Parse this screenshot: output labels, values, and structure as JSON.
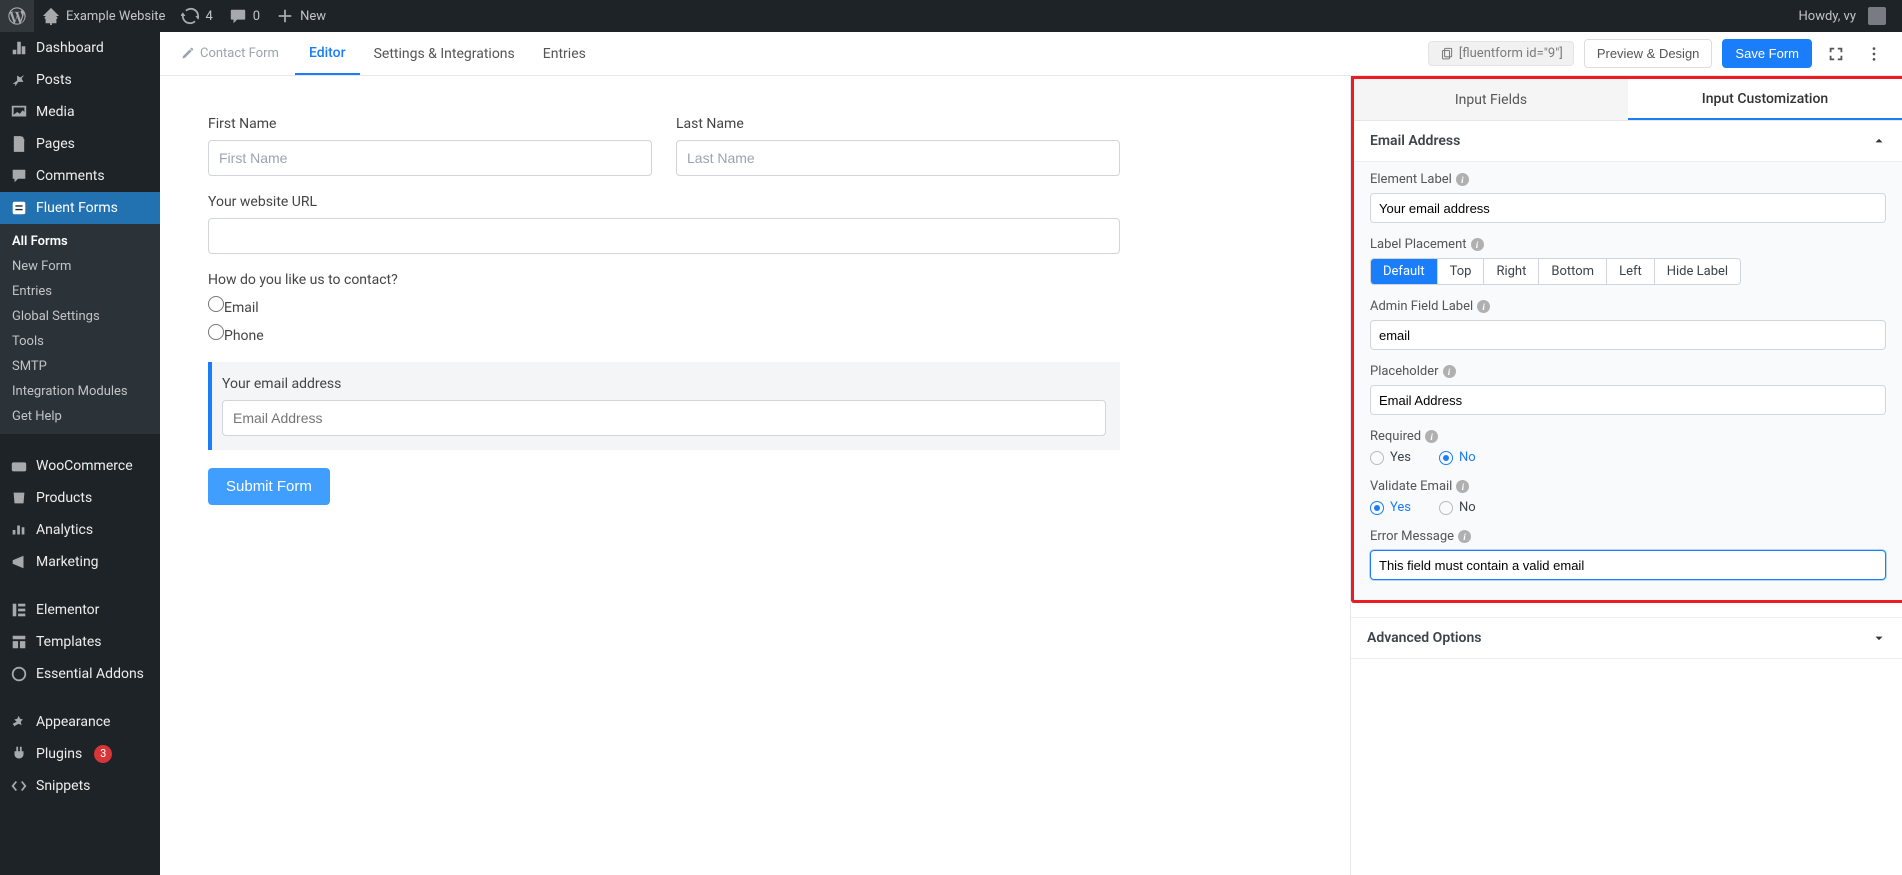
{
  "adminbar": {
    "site_name": "Example Website",
    "updates": "4",
    "comments": "0",
    "new": "New",
    "howdy": "Howdy, vy"
  },
  "sidebar": {
    "items": [
      {
        "label": "Dashboard",
        "icon": "dashboard"
      },
      {
        "label": "Posts",
        "icon": "pin"
      },
      {
        "label": "Media",
        "icon": "media"
      },
      {
        "label": "Pages",
        "icon": "pages"
      },
      {
        "label": "Comments",
        "icon": "comments"
      },
      {
        "label": "Fluent Forms",
        "icon": "form",
        "current": true
      },
      {
        "label": "WooCommerce",
        "icon": "woo"
      },
      {
        "label": "Products",
        "icon": "products"
      },
      {
        "label": "Analytics",
        "icon": "analytics"
      },
      {
        "label": "Marketing",
        "icon": "marketing"
      },
      {
        "label": "Elementor",
        "icon": "elementor"
      },
      {
        "label": "Templates",
        "icon": "templates"
      },
      {
        "label": "Essential Addons",
        "icon": "addons"
      },
      {
        "label": "Appearance",
        "icon": "appearance"
      },
      {
        "label": "Plugins",
        "icon": "plugins",
        "badge": "3"
      },
      {
        "label": "Snippets",
        "icon": "snippets"
      }
    ],
    "sub": [
      "All Forms",
      "New Form",
      "Entries",
      "Global Settings",
      "Tools",
      "SMTP",
      "Integration Modules",
      "Get Help"
    ],
    "sub_current": "All Forms"
  },
  "topbar": {
    "breadcrumb": "Contact Form",
    "tabs": [
      "Editor",
      "Settings & Integrations",
      "Entries"
    ],
    "active_tab": "Editor",
    "shortcode": "[fluentform id=\"9\"]",
    "preview": "Preview & Design",
    "save": "Save Form"
  },
  "form": {
    "first_name_label": "First Name",
    "first_name_placeholder": "First Name",
    "last_name_label": "Last Name",
    "last_name_placeholder": "Last Name",
    "url_label": "Your website URL",
    "contact_label": "How do you like us to contact?",
    "contact_options": [
      "Email",
      "Phone"
    ],
    "email_label": "Your email address",
    "email_placeholder": "Email Address",
    "submit": "Submit Form"
  },
  "panel": {
    "tabs": [
      "Input Fields",
      "Input Customization"
    ],
    "active": "Input Customization",
    "accordion_title": "Email Address",
    "element_label_title": "Element Label",
    "element_label_value": "Your email address",
    "label_placement_title": "Label Placement",
    "label_placement_options": [
      "Default",
      "Top",
      "Right",
      "Bottom",
      "Left",
      "Hide Label"
    ],
    "label_placement_active": "Default",
    "admin_label_title": "Admin Field Label",
    "admin_label_value": "email",
    "placeholder_title": "Placeholder",
    "placeholder_value": "Email Address",
    "required_title": "Required",
    "required_options": [
      "Yes",
      "No"
    ],
    "required_value": "No",
    "validate_title": "Validate Email",
    "validate_options": [
      "Yes",
      "No"
    ],
    "validate_value": "Yes",
    "error_title": "Error Message",
    "error_value": "This field must contain a valid email",
    "advanced": "Advanced Options"
  }
}
